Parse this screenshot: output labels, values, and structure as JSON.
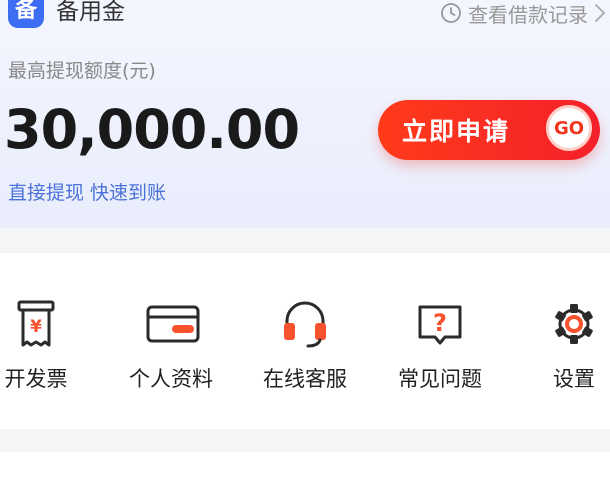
{
  "header": {
    "logo_char": "备",
    "app_name": "备用金",
    "history_link": "查看借款记录"
  },
  "quota": {
    "label": "最高提现额度(元)",
    "amount": "30,000.00",
    "slogan": "直接提现 快速到账"
  },
  "apply_button": {
    "label": "立即申请",
    "go": "GO"
  },
  "menu": {
    "items": [
      {
        "label": "开发票",
        "icon": "invoice-icon"
      },
      {
        "label": "个人资料",
        "icon": "card-icon"
      },
      {
        "label": "在线客服",
        "icon": "headset-icon"
      },
      {
        "label": "常见问题",
        "icon": "faq-icon"
      },
      {
        "label": "设置",
        "icon": "gear-icon"
      }
    ]
  },
  "colors": {
    "brand_blue": "#3d6df2",
    "accent_red": "#f4202a",
    "icon_orange": "#f7512e",
    "slogan_blue": "#4a72d8"
  }
}
